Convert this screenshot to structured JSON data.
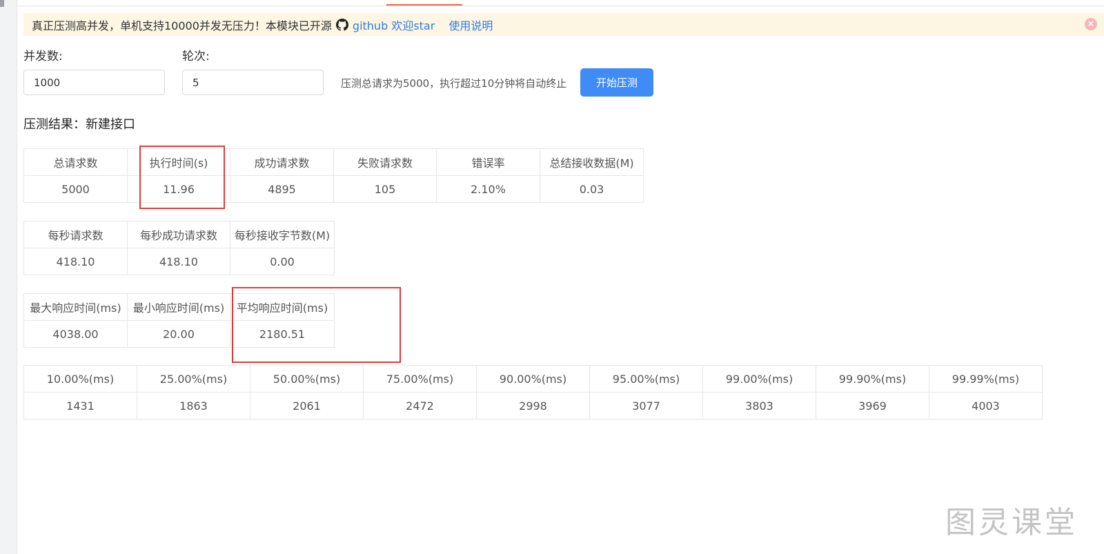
{
  "notice": {
    "text": "真正压测高并发，单机支持10000并发无压力！本模块已开源",
    "github_link": "github 欢迎star",
    "usage_link": "使用说明",
    "github_icon": "github-icon",
    "close_icon": "close-icon"
  },
  "form": {
    "concurrency_label": "并发数:",
    "concurrency_value": "1000",
    "rounds_label": "轮次:",
    "rounds_value": "5",
    "hint": "压测总请求为5000，执行超过10分钟将自动终止",
    "start_button": "开始压测"
  },
  "result": {
    "title": "压测结果：新建接口",
    "table1": {
      "headers": [
        "总请求数",
        "执行时间(s)",
        "成功请求数",
        "失败请求数",
        "错误率",
        "总结接收数据(M)"
      ],
      "values": [
        "5000",
        "11.96",
        "4895",
        "105",
        "2.10%",
        "0.03"
      ]
    },
    "table2": {
      "headers": [
        "每秒请求数",
        "每秒成功请求数",
        "每秒接收字节数(M)"
      ],
      "values": [
        "418.10",
        "418.10",
        "0.00"
      ]
    },
    "table3": {
      "headers": [
        "最大响应时间(ms)",
        "最小响应时间(ms)",
        "平均响应时间(ms)"
      ],
      "values": [
        "4038.00",
        "20.00",
        "2180.51"
      ]
    },
    "table4": {
      "headers": [
        "10.00%(ms)",
        "25.00%(ms)",
        "50.00%(ms)",
        "75.00%(ms)",
        "90.00%(ms)",
        "95.00%(ms)",
        "99.00%(ms)",
        "99.90%(ms)",
        "99.99%(ms)"
      ],
      "values": [
        "1431",
        "1863",
        "2061",
        "2472",
        "2998",
        "3077",
        "3803",
        "3969",
        "4003"
      ]
    }
  },
  "watermark": "图灵课堂",
  "colors": {
    "accent": "#3f8cf7",
    "link": "#2f7be8",
    "notice_bg": "#fdf6e3",
    "highlight": "#e53935",
    "tab_indicator": "#f5653c"
  }
}
